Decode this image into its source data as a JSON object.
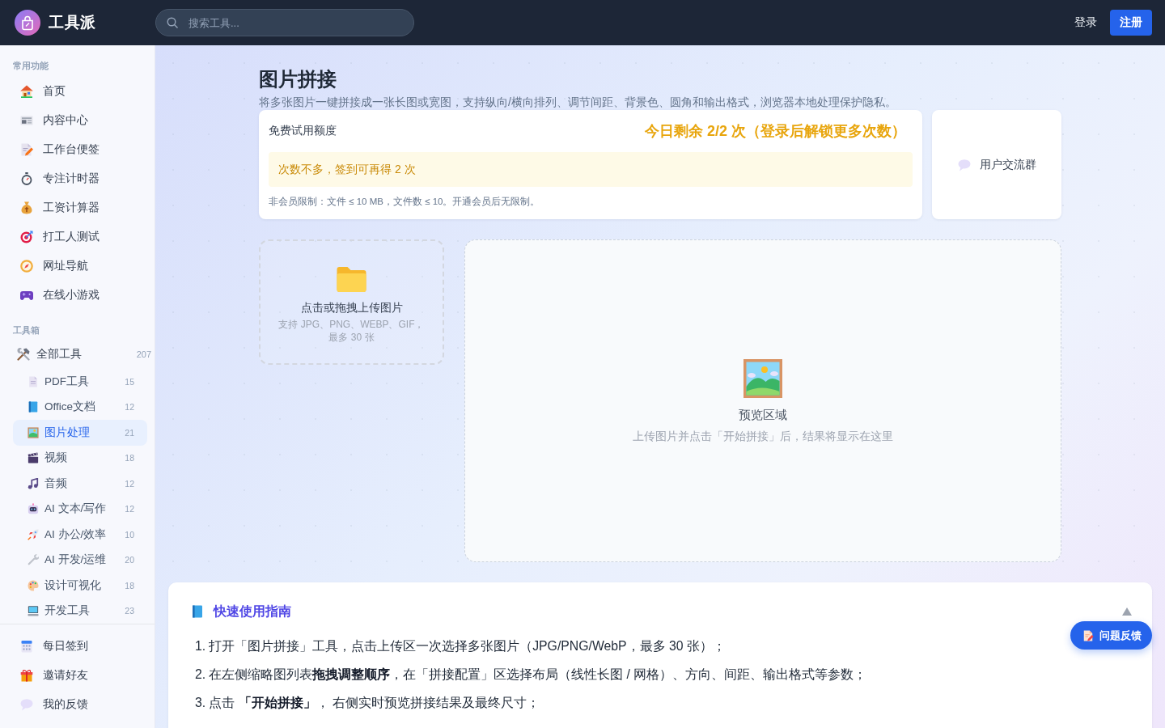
{
  "header": {
    "logo_text": "工具派",
    "search": {
      "placeholder": "搜索工具..."
    },
    "login": "登录",
    "register": "注册"
  },
  "sidebar": {
    "common": {
      "label": "常用功能",
      "items": [
        {
          "label": "首页",
          "selected": false
        },
        {
          "label": "内容中心",
          "selected": false
        },
        {
          "label": "工作台便签",
          "selected": false
        },
        {
          "label": "专注计时器",
          "selected": false
        },
        {
          "label": "工资计算器",
          "selected": false
        },
        {
          "label": "打工人测试",
          "selected": false
        },
        {
          "label": "网址导航",
          "selected": false
        },
        {
          "label": "在线小游戏",
          "selected": false
        }
      ]
    },
    "toolbox": {
      "label": "工具箱",
      "items": [
        {
          "label": "全部工具",
          "count": "207",
          "selected": false,
          "children": [
            {
              "label": "PDF工具",
              "count": "15",
              "selected": false
            },
            {
              "label": "Office文档",
              "count": "12",
              "selected": false
            },
            {
              "label": "图片处理",
              "count": "21",
              "selected": true
            },
            {
              "label": "视频",
              "count": "18",
              "selected": false
            },
            {
              "label": "音频",
              "count": "12",
              "selected": false
            },
            {
              "label": "AI 文本/写作",
              "count": "12",
              "selected": false
            },
            {
              "label": "AI 办公/效率",
              "count": "10",
              "selected": false
            },
            {
              "label": "AI 开发/运维",
              "count": "20",
              "selected": false
            },
            {
              "label": "设计可视化",
              "count": "18",
              "selected": false
            },
            {
              "label": "开发工具",
              "count": "23",
              "selected": false
            }
          ]
        }
      ]
    },
    "footer_items": [
      {
        "label": "每日签到",
        "selected": false
      },
      {
        "label": "邀请好友",
        "selected": false
      },
      {
        "label": "我的反馈",
        "selected": false
      }
    ]
  },
  "main": {
    "title": "图片拼接",
    "subtitle": "将多张图片一键拼接成一张长图或宽图，支持纵向/横向排列、调节间距、背景色、圆角和输出格式，浏览器本地处理保护隐私。",
    "quota_card": {
      "label": "免费试用额度",
      "remaining": "今日剩余 2/2 次（登录后解锁更多次数）",
      "notice": "次数不多，签到可再得 2 次",
      "limits": "非会员限制：文件 ≤ 10 MB，文件数 ≤ 10。开通会员后无限制。"
    },
    "community_card": {
      "label": "用户交流群"
    },
    "upload": {
      "title": "点击或拖拽上传图片",
      "hint": "支持 JPG、PNG、WEBP、GIF，最多 30 张"
    },
    "preview": {
      "title": "预览区域",
      "hint": "上传图片并点击「开始拼接」后，结果将显示在这里"
    },
    "guide": {
      "title": "快速使用指南",
      "expanded": true,
      "steps": [
        {
          "number": "1.",
          "text": "打开「图片拼接」工具，点击上传区一次选择多张图片（JPG/PNG/WebP，最多 30 张）；"
        },
        {
          "number": "2.",
          "text": "在左侧缩略图列表**拖拽调整顺序**，在「拼接配置」区选择布局（线性长图 / 网格）、方向、间距、输出格式等参数；"
        },
        {
          "number": "3.",
          "text": "点击 **「开始拼接」**， 右侧实时预览拼接结果及最终尺寸；"
        }
      ]
    },
    "feedback_button": "问题反馈"
  }
}
